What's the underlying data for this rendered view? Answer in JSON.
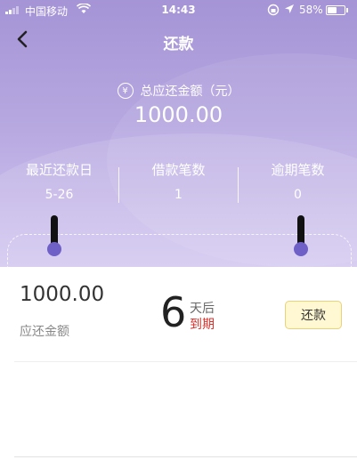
{
  "status_bar": {
    "carrier": "中国移动",
    "time": "14:43",
    "battery_percent": "58%",
    "battery_level": 0.58
  },
  "nav": {
    "title": "还款",
    "back_icon": "chevron-left-icon"
  },
  "summary": {
    "total_label": "总应还金额（元）",
    "currency_symbol": "¥",
    "total_amount": "1000.00",
    "stats": [
      {
        "label": "最近还款日",
        "value": "5-26"
      },
      {
        "label": "借款笔数",
        "value": "1"
      },
      {
        "label": "逾期笔数",
        "value": "0"
      }
    ]
  },
  "bill": {
    "amount": "1000.00",
    "amount_label": "应还金额",
    "days": "6",
    "days_suffix": "天后",
    "due_label": "到期",
    "pay_button": "还款"
  },
  "colors": {
    "hero_top": "#a594d6",
    "due_red": "#d9312b",
    "button_bg": "#fff8d2",
    "pin_dot": "#6f60c8"
  }
}
